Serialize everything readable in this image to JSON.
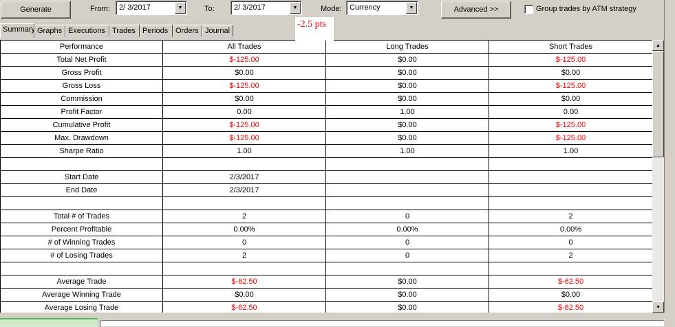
{
  "toolbar": {
    "generate_label": "Generate",
    "from_label": "From:",
    "from_value": "2/  3/2017",
    "to_label": "To:",
    "to_value": "2/  3/2017",
    "mode_label": "Mode:",
    "mode_value": "Currency",
    "advanced_label": "Advanced >>",
    "group_label": "Group trades by ATM strategy",
    "group_checked": false
  },
  "tabs": [
    "Summary",
    "Graphs",
    "Executions",
    "Trades",
    "Periods",
    "Orders",
    "Journal"
  ],
  "active_tab": "Summary",
  "overlay_text": "-2.5 pts",
  "table": {
    "headers": [
      "Performance",
      "All Trades",
      "Long Trades",
      "Short Trades"
    ],
    "rows": [
      {
        "label": "Total Net Profit",
        "all": "$-125.00",
        "long": "$0.00",
        "short": "$-125.00",
        "red": [
          true,
          false,
          true
        ]
      },
      {
        "label": "Gross Profit",
        "all": "$0.00",
        "long": "$0.00",
        "short": "$0.00",
        "red": [
          false,
          false,
          false
        ]
      },
      {
        "label": "Gross Loss",
        "all": "$-125.00",
        "long": "$0.00",
        "short": "$-125.00",
        "red": [
          true,
          false,
          true
        ]
      },
      {
        "label": "Commission",
        "all": "$0.00",
        "long": "$0.00",
        "short": "$0.00",
        "red": [
          false,
          false,
          false
        ]
      },
      {
        "label": "Profit Factor",
        "all": "0.00",
        "long": "1.00",
        "short": "0.00",
        "red": [
          false,
          false,
          false
        ]
      },
      {
        "label": "Cumulative Profit",
        "all": "$-125.00",
        "long": "$0.00",
        "short": "$-125.00",
        "red": [
          true,
          false,
          true
        ]
      },
      {
        "label": "Max. Drawdown",
        "all": "$-125.00",
        "long": "$0.00",
        "short": "$-125.00",
        "red": [
          true,
          false,
          true
        ]
      },
      {
        "label": "Sharpe Ratio",
        "all": "1.00",
        "long": "1.00",
        "short": "1.00",
        "red": [
          false,
          false,
          false
        ]
      },
      {
        "label": "",
        "all": "",
        "long": "",
        "short": "",
        "red": [
          false,
          false,
          false
        ]
      },
      {
        "label": "Start Date",
        "all": "2/3/2017",
        "long": "",
        "short": "",
        "red": [
          false,
          false,
          false
        ]
      },
      {
        "label": "End Date",
        "all": "2/3/2017",
        "long": "",
        "short": "",
        "red": [
          false,
          false,
          false
        ]
      },
      {
        "label": "",
        "all": "",
        "long": "",
        "short": "",
        "red": [
          false,
          false,
          false
        ]
      },
      {
        "label": "Total # of Trades",
        "all": "2",
        "long": "0",
        "short": "2",
        "red": [
          false,
          false,
          false
        ]
      },
      {
        "label": "Percent Profitable",
        "all": "0.00%",
        "long": "0.00%",
        "short": "0.00%",
        "red": [
          false,
          false,
          false
        ]
      },
      {
        "label": "# of Winning Trades",
        "all": "0",
        "long": "0",
        "short": "0",
        "red": [
          false,
          false,
          false
        ]
      },
      {
        "label": "# of Losing Trades",
        "all": "2",
        "long": "0",
        "short": "2",
        "red": [
          false,
          false,
          false
        ]
      },
      {
        "label": "",
        "all": "",
        "long": "",
        "short": "",
        "red": [
          false,
          false,
          false
        ]
      },
      {
        "label": "Average Trade",
        "all": "$-62.50",
        "long": "$0.00",
        "short": "$-62.50",
        "red": [
          true,
          false,
          true
        ]
      },
      {
        "label": "Average Winning Trade",
        "all": "$0.00",
        "long": "$0.00",
        "short": "$0.00",
        "red": [
          false,
          false,
          false
        ]
      },
      {
        "label": "Average Losing Trade",
        "all": "$-62.50",
        "long": "$0.00",
        "short": "$-62.50",
        "red": [
          true,
          false,
          true
        ]
      }
    ]
  },
  "colors": {
    "negative": "#ff0000",
    "status_green": "#4cbf4c"
  },
  "icons": {
    "dropdown": "triangle-down",
    "scroll_up": "triangle-up",
    "scroll_down": "triangle-down"
  }
}
